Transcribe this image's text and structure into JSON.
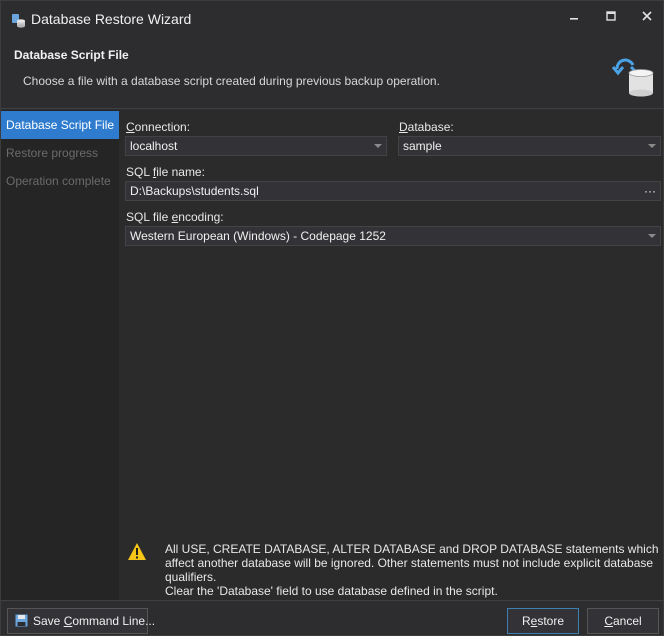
{
  "window": {
    "title": "Database Restore Wizard"
  },
  "header": {
    "title": "Database Script File",
    "description": "Choose a file with a database script created during previous backup operation."
  },
  "steps": [
    {
      "label": "Database Script File",
      "active": true
    },
    {
      "label": "Restore progress",
      "active": false
    },
    {
      "label": "Operation complete",
      "active": false
    }
  ],
  "form": {
    "connection_label_key": "C",
    "connection_label_rest": "onnection:",
    "connection_value": "localhost",
    "database_label_key": "D",
    "database_label_rest": "atabase:",
    "database_value": "sample",
    "file_label_pre": "SQL ",
    "file_label_key": "f",
    "file_label_rest": "ile name:",
    "file_value": "D:\\Backups\\students.sql",
    "file_browse": "···",
    "encoding_label_pre": "SQL file ",
    "encoding_label_key": "e",
    "encoding_label_rest": "ncoding:",
    "encoding_value": "Western European (Windows) - Codepage 1252"
  },
  "warning": {
    "text": "All USE, CREATE DATABASE, ALTER DATABASE and DROP DATABASE statements which affect another database will be ignored. Other statements must not include explicit database qualifiers.",
    "hint": "Clear the 'Database' field to use database defined in the script."
  },
  "footer": {
    "save_label_pre": "Save ",
    "save_label_key": "C",
    "save_label_rest": "ommand Line...",
    "restore_label_pre": "R",
    "restore_label_key": "e",
    "restore_label_rest": "store",
    "cancel_label_key": "C",
    "cancel_label_rest": "ancel"
  },
  "colors": {
    "accent": "#2f7ccf",
    "background": "#2b2b2b",
    "warning": "#f5c518"
  },
  "icons": {
    "app": "database-wizard-icon",
    "header": "database-restore-icon",
    "warning": "warning-icon",
    "save": "floppy-disk-icon"
  }
}
